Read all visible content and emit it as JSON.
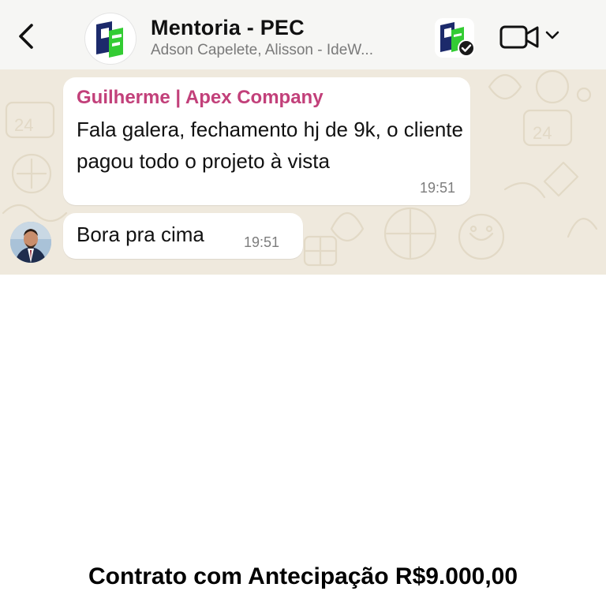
{
  "header": {
    "title": "Mentoria - PEC",
    "subtitle": "Adson Capelete, Alisson - IdeW..."
  },
  "messages": [
    {
      "sender": "Guilherme | Apex Company",
      "text": "Fala galera, fechamento hj de 9k, o cliente pagou todo o projeto à vista",
      "time": "19:51"
    },
    {
      "text": "Bora pra cima",
      "time": "19:51"
    }
  ],
  "caption": "Contrato com Antecipação R$9.000,00",
  "colors": {
    "sender_name": "#c2407a",
    "chat_wallpaper": "#efe9dd",
    "bubble": "#ffffff",
    "logo_navy": "#1c2a6b",
    "logo_green": "#33cc33"
  },
  "icons": [
    "back-icon",
    "group-avatar-logo",
    "community-icon",
    "verified-check-icon",
    "video-call-icon",
    "chevron-down-icon",
    "user-avatar"
  ]
}
